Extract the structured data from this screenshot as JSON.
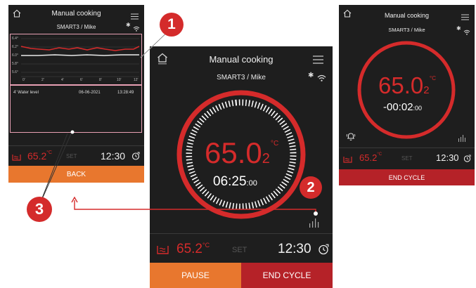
{
  "left_screen": {
    "title": "Manual cooking",
    "subtitle": "SMART3 / Mike",
    "chart": {
      "y_ticks": [
        "6.4°",
        "6.2°",
        "6.0°",
        "5.8°",
        "5.6°"
      ],
      "x_ticks": [
        "0'",
        "2'",
        "4'",
        "6'",
        "8'",
        "10'",
        "12'"
      ]
    },
    "log": {
      "item": "4'  Water level",
      "date": "06-06-2021",
      "time": "13:28:49"
    },
    "temp": "65.2",
    "temp_unit": "°C",
    "set_label": "SET",
    "clock": "12:30",
    "back_button": "BACK"
  },
  "center_screen": {
    "title": "Manual cooking",
    "subtitle": "SMART3 / Mike",
    "big_temp": "65.0",
    "big_temp_sub": "2",
    "big_unit": "°C",
    "timer_main": "06:25",
    "timer_small": ":00",
    "temp": "65.2",
    "temp_unit": "°C",
    "set_label": "SET",
    "clock": "12:30",
    "pause_button": "PAUSE",
    "end_button": "END CYCLE"
  },
  "right_screen": {
    "title": "Manual cooking",
    "subtitle": "SMART3 / Mike",
    "big_temp": "65.0",
    "big_temp_sub": "2",
    "big_unit": "°C",
    "timer_main": "-00:02",
    "timer_small": ":00",
    "temp": "65.2",
    "temp_unit": "°C",
    "set_label": "SET",
    "clock": "12:30",
    "end_button": "END CYCLE"
  },
  "callouts": [
    "1",
    "2",
    "3"
  ],
  "colors": {
    "screen_bg": "#1e1e1e",
    "accent_red": "#d52b2b",
    "orange": "#e8772e",
    "dark_red": "#b52228",
    "callout_box": "#e8a0b4"
  }
}
